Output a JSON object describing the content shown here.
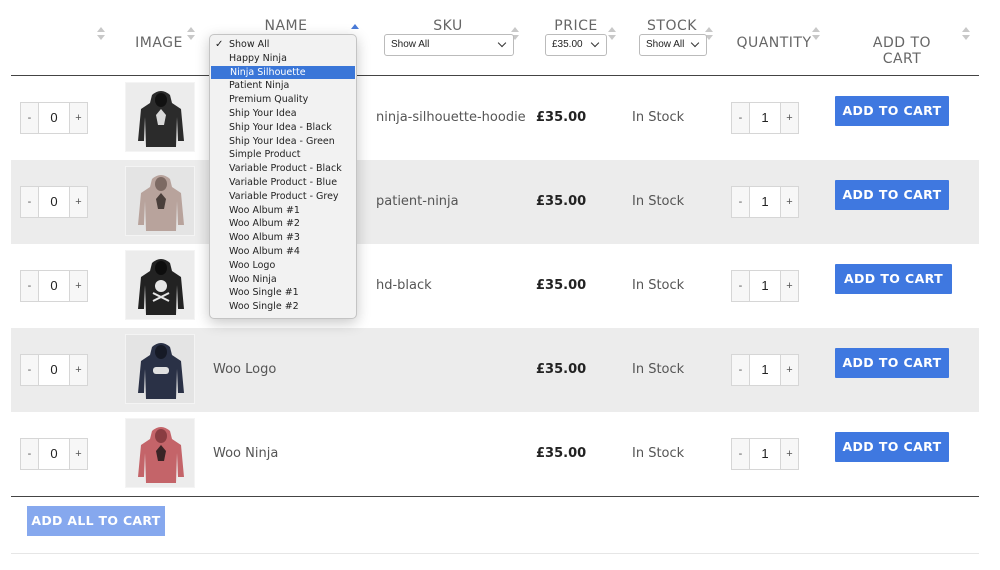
{
  "header": {
    "image": "IMAGE",
    "name": "NAME",
    "sku": "SKU",
    "price": "PRICE",
    "stock": "STOCK",
    "quantity": "QUANTITY",
    "add_to_cart": "ADD TO CART"
  },
  "filters": {
    "sku": "Show All",
    "price": "£35.00",
    "stock": "Show All"
  },
  "name_dropdown": {
    "checked": "Show All",
    "highlighted": "Ninja Silhouette",
    "options": [
      "Show All",
      "Happy Ninja",
      "Ninja Silhouette",
      "Patient Ninja",
      "Premium Quality",
      "Ship Your Idea",
      "Ship Your Idea - Black",
      "Ship Your Idea - Green",
      "Simple Product",
      "Variable Product - Black",
      "Variable Product - Blue",
      "Variable Product - Grey",
      "Woo Album #1",
      "Woo Album #2",
      "Woo Album #3",
      "Woo Album #4",
      "Woo Logo",
      "Woo Ninja",
      "Woo Single #1",
      "Woo Single #2"
    ]
  },
  "stepper": {
    "minus": "-",
    "plus": "+"
  },
  "rows": [
    {
      "select_qty": "0",
      "name": "",
      "sku": "ninja-silhouette-hoodie",
      "price": "£35.00",
      "stock": "In Stock",
      "quantity": "1",
      "button": "ADD TO CART",
      "hoodie_color": "#2b2b2b",
      "print": "ninja"
    },
    {
      "select_qty": "0",
      "name": "",
      "sku": "patient-ninja",
      "price": "£35.00",
      "stock": "In Stock",
      "quantity": "1",
      "button": "ADD TO CART",
      "hoodie_color": "#b8a39c",
      "print": "ninja"
    },
    {
      "select_qty": "0",
      "name": "",
      "sku": "hd-black",
      "price": "£35.00",
      "stock": "In Stock",
      "quantity": "1",
      "button": "ADD TO CART",
      "hoodie_color": "#222222",
      "print": "skull"
    },
    {
      "select_qty": "0",
      "name": "Woo Logo",
      "sku": "",
      "price": "£35.00",
      "stock": "In Stock",
      "quantity": "1",
      "button": "ADD TO CART",
      "hoodie_color": "#2a3146",
      "print": "woo"
    },
    {
      "select_qty": "0",
      "name": "Woo Ninja",
      "sku": "",
      "price": "£35.00",
      "stock": "In Stock",
      "quantity": "1",
      "button": "ADD TO CART",
      "hoodie_color": "#c46469",
      "print": "ninja"
    }
  ],
  "footer": {
    "add_all": "ADD ALL TO CART"
  },
  "colors": {
    "accent": "#3f78e0",
    "accent_light": "#86a8ee",
    "row_shade": "#ececec"
  }
}
